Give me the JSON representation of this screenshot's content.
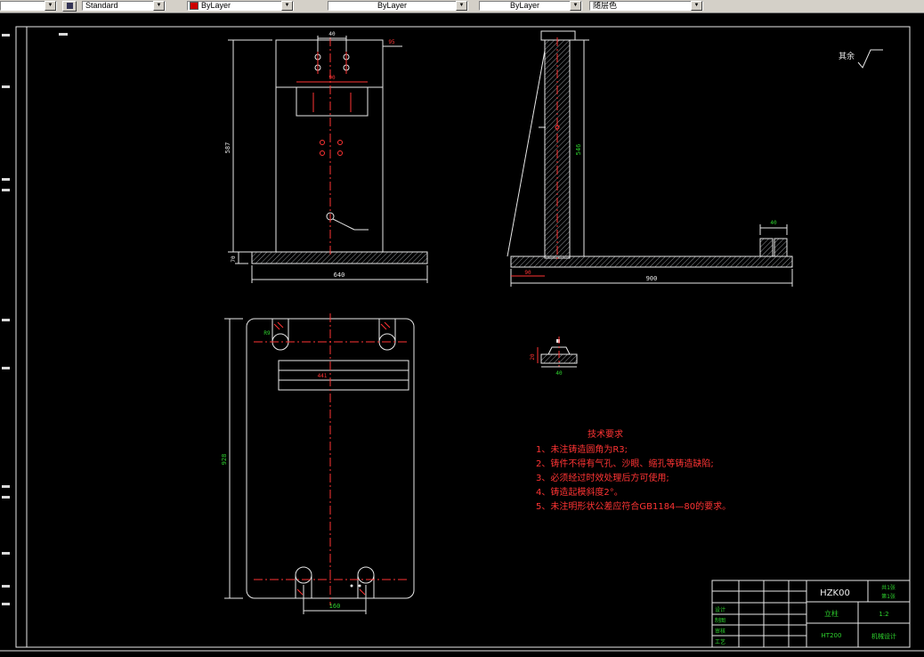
{
  "toolbar": {
    "layer_value": "",
    "style_value": "Standard",
    "color_value": "ByLayer",
    "linetype_value": "ByLayer",
    "lineweight_value": "ByLayer",
    "plotstyle_value": "随层色"
  },
  "drawing": {
    "surface_note": "其余",
    "tech_requirements": {
      "title": "技术要求",
      "items": [
        "1、未注铸造圆角为R3;",
        "2、铸件不得有气孔、沙眼、缩孔等铸造缺陷;",
        "3、必须经过时效处理后方可使用;",
        "4、铸造起模斜度2°。",
        "5、未注明形状公差应符合GB1184—80的要求。"
      ]
    },
    "dims": {
      "front": {
        "width_top": "40",
        "offset_right": "95",
        "boss": "90",
        "height": "587",
        "base_height": "70",
        "base_width": "640"
      },
      "side": {
        "height": "546",
        "length": "900",
        "left": "90",
        "end": "40"
      },
      "plan": {
        "length": "928",
        "band": "441",
        "slot_span": "160",
        "slot_radius": "R9"
      },
      "detail": {
        "width": "40",
        "height": "20"
      }
    },
    "title_block": {
      "drawing_number": "HZK00",
      "part_name": "立柱",
      "material": "HT200",
      "scale": "1:2",
      "sheet": "共1张",
      "page": "第1张",
      "company": "机械设计",
      "rows": [
        "设计",
        "制图",
        "审核",
        "工艺"
      ]
    }
  }
}
